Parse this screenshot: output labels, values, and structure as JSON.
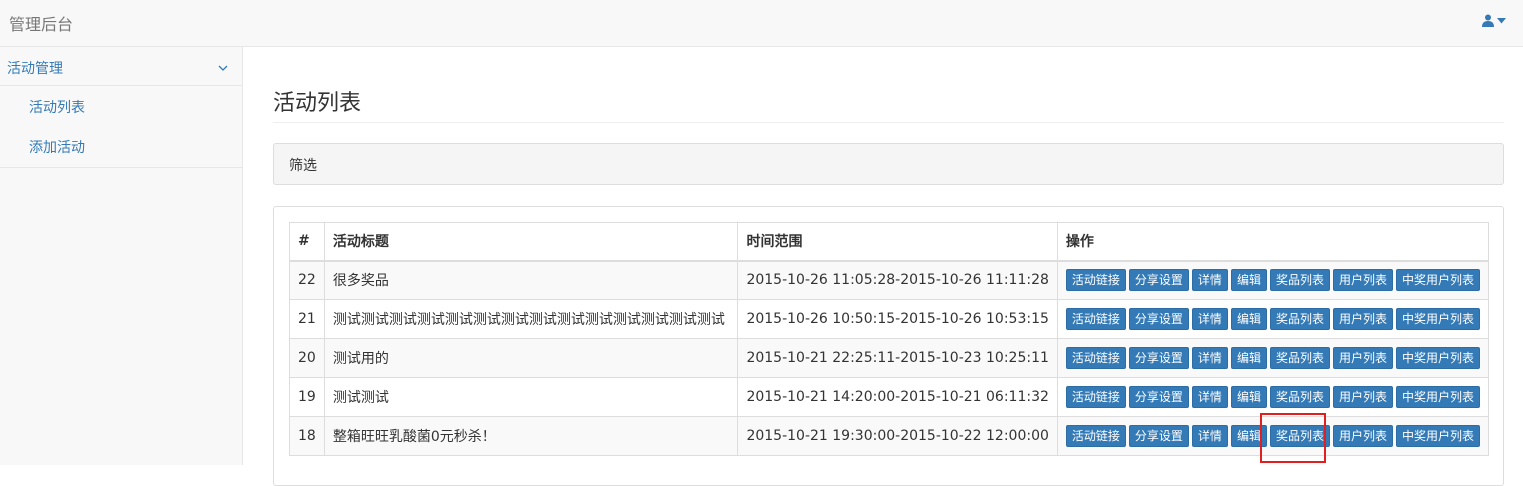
{
  "header": {
    "brand": "管理后台"
  },
  "sidebar": {
    "group_label": "活动管理",
    "items": [
      {
        "label": "活动列表"
      },
      {
        "label": "添加活动"
      }
    ]
  },
  "main": {
    "title": "活动列表",
    "filter_label": "筛选",
    "table": {
      "headers": [
        "#",
        "活动标题",
        "时间范围",
        "操作"
      ],
      "actions": [
        "活动链接",
        "分享设置",
        "详情",
        "编辑",
        "奖品列表",
        "用户列表",
        "中奖用户列表"
      ],
      "rows": [
        {
          "id": "22",
          "title": "很多奖品",
          "time": "2015-10-26 11:05:28-2015-10-26 11:11:28"
        },
        {
          "id": "21",
          "title": "测试测试测试测试测试测试测试测试测试测试测试测试测试测试",
          "time": "2015-10-26 10:50:15-2015-10-26 10:53:15"
        },
        {
          "id": "20",
          "title": "测试用的",
          "time": "2015-10-21 22:25:11-2015-10-23 10:25:11"
        },
        {
          "id": "19",
          "title": "测试测试",
          "time": "2015-10-21 14:20:00-2015-10-21 06:11:32"
        },
        {
          "id": "18",
          "title": "整箱旺旺乳酸菌0元秒杀！",
          "time": "2015-10-21 19:30:00-2015-10-22 12:00:00"
        }
      ]
    }
  },
  "icons": {
    "user": "user-icon",
    "caret": "caret-down-icon",
    "chevron": "chevron-down-icon"
  },
  "colors": {
    "link": "#337ab7",
    "button": "#337ab7",
    "highlight": "#e02020"
  }
}
